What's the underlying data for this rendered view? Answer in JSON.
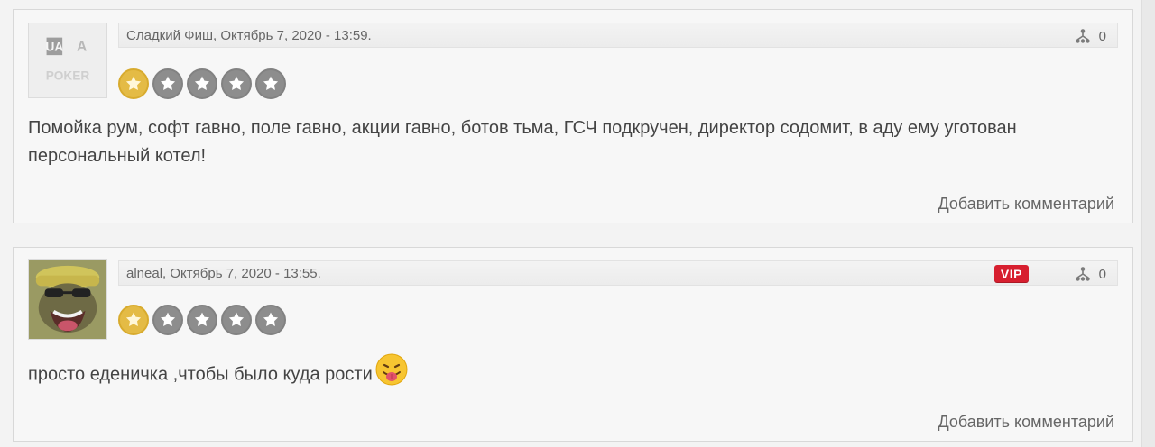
{
  "reviews": [
    {
      "author": "Сладкий Фиш",
      "date": "Октябрь 7, 2020 - 13:59.",
      "vote_count": "0",
      "rating": 1,
      "text": "Помойка рум, софт гавно, поле гавно, акции гавно, ботов тьма, ГСЧ подкручен, директор содомит, в аду ему уготован персональный котел!",
      "add_comment": "Добавить комментарий",
      "avatar_logo": {
        "line1": "UA",
        "line2": "POKER"
      }
    },
    {
      "author": "alneal",
      "date": "Октябрь 7, 2020 - 13:55.",
      "vote_count": "0",
      "vip": "VIP",
      "rating": 1,
      "text": "просто еденичка ,чтобы было куда рости",
      "add_comment": "Добавить комментарий"
    }
  ],
  "colors": {
    "star_filled": "#e4bb45",
    "star_empty": "#8d8d8d",
    "vip": "#d71f2f"
  },
  "icons": {
    "vote": "hierarchy-icon",
    "avatar1": "ua-poker-logo",
    "avatar2": "character-avatar",
    "emoji": "tongue-emoji"
  }
}
